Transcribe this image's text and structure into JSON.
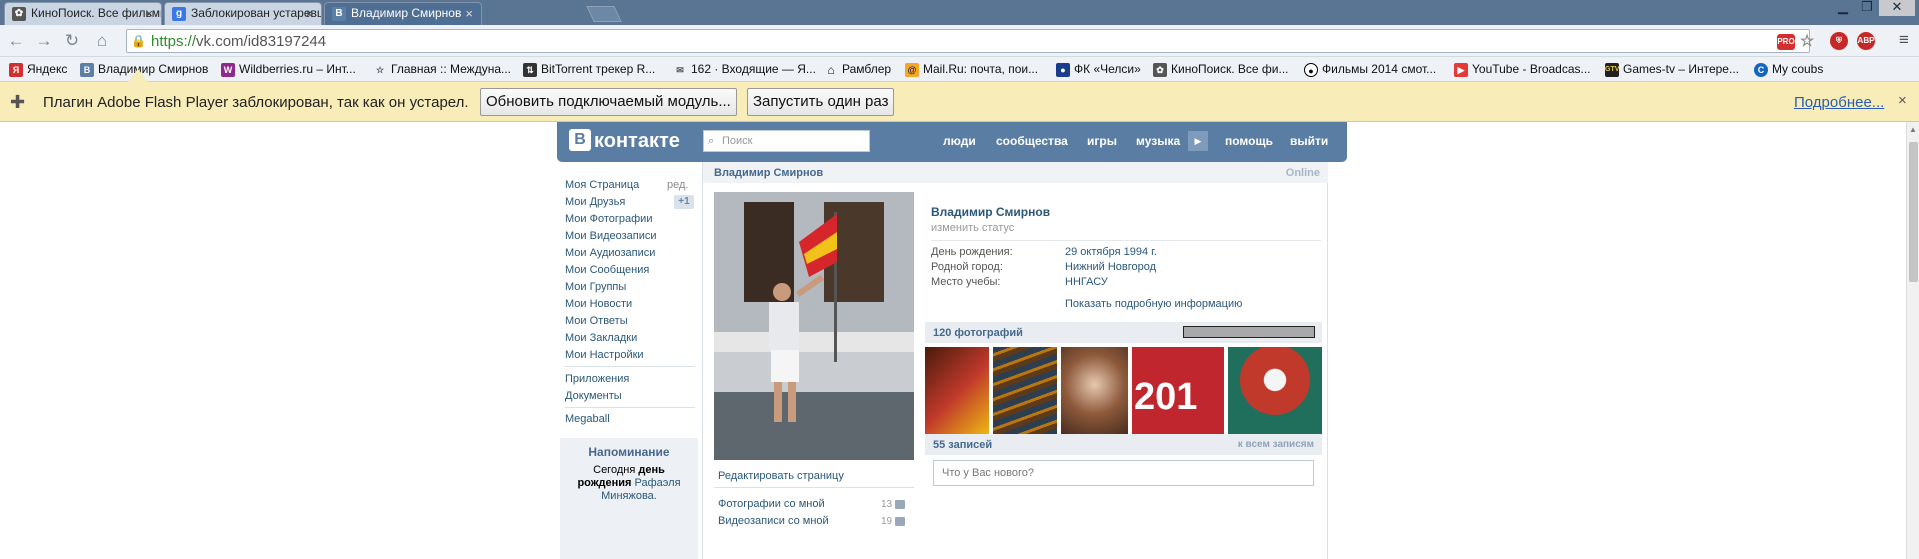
{
  "browser": {
    "tabs": [
      {
        "title": "КиноПоиск. Все фильмы",
        "icon": "kinopoisk-icon",
        "active": false
      },
      {
        "title": "Заблокирован устаревш",
        "icon": "google-icon",
        "active": false
      },
      {
        "title": "Владимир Смирнов",
        "icon": "vk-icon",
        "active": true
      }
    ],
    "url_protocol": "https://",
    "url_rest": "vk.com/id83197244",
    "bookmarks": [
      {
        "label": "Яндекс",
        "icon": "yandex-icon"
      },
      {
        "label": "Владимир Смирнов",
        "icon": "vk-icon"
      },
      {
        "label": "Wildberries.ru – Инт...",
        "icon": "wildberries-icon"
      },
      {
        "label": "Главная :: Междуна...",
        "icon": "star-icon"
      },
      {
        "label": "BitTorrent трекер R...",
        "icon": "torrent-icon"
      },
      {
        "label": "162 · Входящие — Я...",
        "icon": "mail-icon"
      },
      {
        "label": "Рамблер",
        "icon": "home-icon"
      },
      {
        "label": "Mail.Ru: почта, пои...",
        "icon": "mailru-icon"
      },
      {
        "label": "ФК «Челси»",
        "icon": "chelsea-icon"
      },
      {
        "label": "КиноПоиск. Все фи...",
        "icon": "kinopoisk-icon"
      },
      {
        "label": "Фильмы 2014 смот...",
        "icon": "panda-icon"
      },
      {
        "label": "YouTube - Broadcas...",
        "icon": "youtube-icon"
      },
      {
        "label": "Games-tv – Интере...",
        "icon": "gamestv-icon"
      },
      {
        "label": "My coubs",
        "icon": "coub-icon"
      }
    ],
    "extensions": [
      {
        "label": "PRO",
        "icon": "pro-icon"
      },
      {
        "label": "ABP",
        "icon": "adblock-icon"
      }
    ],
    "infobar": {
      "message": "Плагин Adobe Flash Player заблокирован, так как он устарел.",
      "update_button": "Обновить подключаемый модуль...",
      "run_once_button": "Запустить один раз",
      "more_link": "Подробнее...",
      "close": "×"
    }
  },
  "vk": {
    "logo": "контакте",
    "logo_letter": "В",
    "search_placeholder": "Поиск",
    "nav": [
      "люди",
      "сообщества",
      "игры",
      "музыка",
      "помощь",
      "выйти"
    ],
    "left_menu": [
      "Моя Страница",
      "Мои Друзья",
      "Мои Фотографии",
      "Мои Видеозаписи",
      "Мои Аудиозаписи",
      "Мои Сообщения",
      "Мои Группы",
      "Мои Новости",
      "Мои Ответы",
      "Мои Закладки",
      "Мои Настройки"
    ],
    "edit_label": "ред.",
    "friends_badge": "+1",
    "left_menu_2": [
      "Приложения",
      "Документы"
    ],
    "left_menu_3": [
      "Megaball"
    ],
    "reminder": {
      "title": "Напоминание",
      "text_1": "Сегодня",
      "text_bold": "день рождения",
      "name": "Рафаэля Миняжова."
    },
    "profile": {
      "header_name": "Владимир Смирнов",
      "online": "Online",
      "full_name": "Владимир Смирнов",
      "change_status": "изменить статус",
      "info": [
        {
          "label": "День рождения:",
          "value": "29 октября 1994 г."
        },
        {
          "label": "Родной город:",
          "value": "Нижний Новгород"
        },
        {
          "label": "Место учебы:",
          "value": "ННГАСУ"
        }
      ],
      "show_more": "Показать подробную информацию",
      "edit_page": "Редактировать страницу",
      "photos_with_me": "Фотографии со мной",
      "photos_with_me_count": "13",
      "videos_with_me": "Видеозаписи со мной",
      "videos_with_me_count": "19",
      "photos_title": "120 фотографий",
      "wall_title": "55 записей",
      "wall_all": "к всем записям",
      "wall_placeholder": "Что у Вас нового?"
    }
  }
}
